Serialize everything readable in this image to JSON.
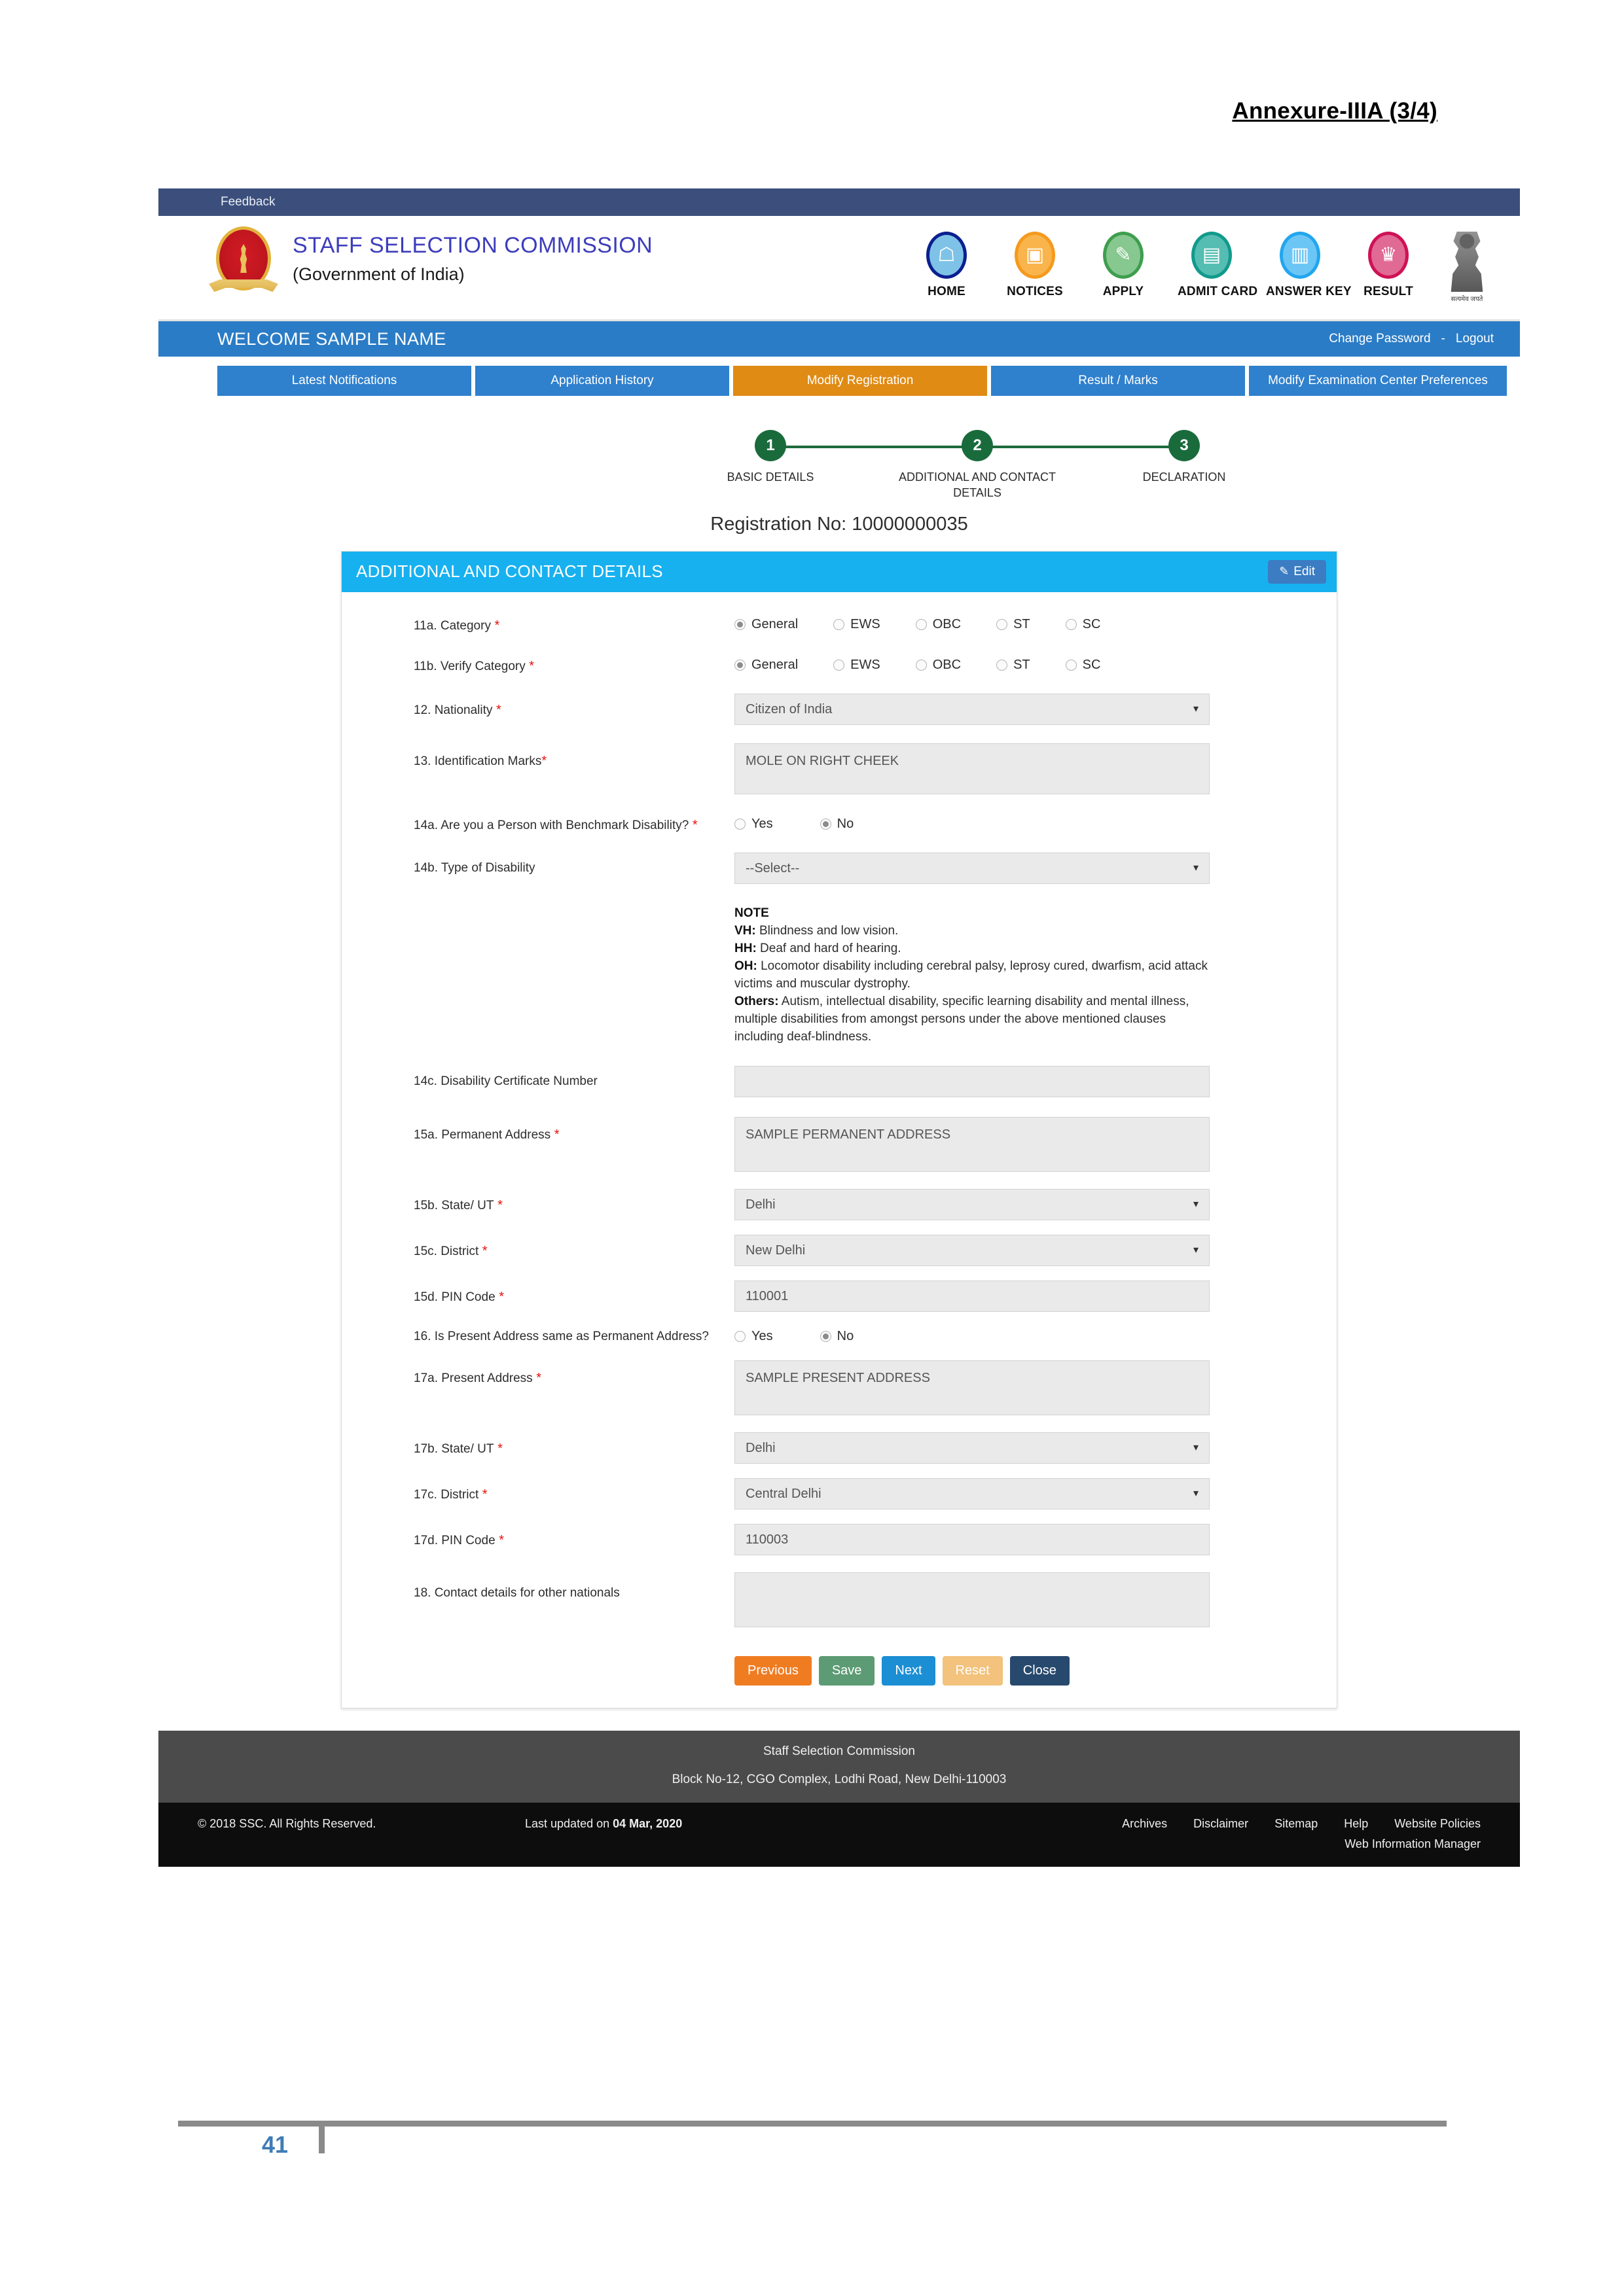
{
  "document": {
    "annexure_label": "Annexure-IIIA (3/4)",
    "page_number": "41"
  },
  "topbar": {
    "feedback_label": "Feedback"
  },
  "brand": {
    "title": "STAFF SELECTION COMMISSION",
    "subtitle": "(Government of India)",
    "logo_icon": "ssc-emblem-icon",
    "national_emblem_icon": "india-national-emblem-icon",
    "national_emblem_caption": "सत्यमेव जयते"
  },
  "nav": {
    "items": [
      {
        "label": "HOME",
        "icon": "home-icon",
        "glyph": "⌂",
        "ring": "#0b1f8f",
        "fill": "#7ec2e8"
      },
      {
        "label": "NOTICES",
        "icon": "notices-icon",
        "glyph": "▣",
        "ring": "#f59a1e",
        "fill": "#f9b44c"
      },
      {
        "label": "APPLY",
        "icon": "apply-edit-icon",
        "glyph": "✎",
        "ring": "#3f9e4e",
        "fill": "#86c88f"
      },
      {
        "label": "ADMIT CARD",
        "icon": "admit-card-icon",
        "glyph": "▤",
        "ring": "#119a8c",
        "fill": "#55bdb2"
      },
      {
        "label": "ANSWER KEY",
        "icon": "answer-key-icon",
        "glyph": "▥",
        "ring": "#22a6ef",
        "fill": "#6cc6f5"
      },
      {
        "label": "RESULT",
        "icon": "result-trophy-icon",
        "glyph": "♜",
        "ring": "#cf1155",
        "fill": "#e06a93"
      }
    ]
  },
  "welcome": {
    "greeting": "WELCOME SAMPLE NAME",
    "change_password": "Change Password",
    "separator": "-",
    "logout": "Logout"
  },
  "tabs": [
    {
      "label": "Latest Notifications",
      "active": false
    },
    {
      "label": "Application History",
      "active": false
    },
    {
      "label": "Modify Registration",
      "active": true
    },
    {
      "label": "Result / Marks",
      "active": false
    },
    {
      "label": "Modify Examination Center Preferences",
      "active": false
    }
  ],
  "stepper": {
    "steps": [
      {
        "number": "1",
        "label": "BASIC DETAILS"
      },
      {
        "number": "2",
        "label": "ADDITIONAL AND CONTACT DETAILS"
      },
      {
        "number": "3",
        "label": "DECLARATION"
      }
    ],
    "registration_line": "Registration No: 10000000035"
  },
  "panel": {
    "title": "ADDITIONAL AND CONTACT DETAILS",
    "edit_label": "Edit",
    "edit_icon": "pencil-square-icon"
  },
  "fields": {
    "category": {
      "label": "11a. Category",
      "required": true,
      "options": [
        "General",
        "EWS",
        "OBC",
        "ST",
        "SC"
      ],
      "selected": "General"
    },
    "verify_category": {
      "label": "11b. Verify Category",
      "required": true,
      "options": [
        "General",
        "EWS",
        "OBC",
        "ST",
        "SC"
      ],
      "selected": "General"
    },
    "nationality": {
      "label": "12. Nationality",
      "required": true,
      "value": "Citizen of India"
    },
    "identification_marks": {
      "label": "13. Identification Marks",
      "required": true,
      "value": "MOLE ON RIGHT CHEEK"
    },
    "benchmark_disability": {
      "label": "14a. Are you a Person with Benchmark Disability?",
      "required": true,
      "options": [
        "Yes",
        "No"
      ],
      "selected": "No"
    },
    "type_of_disability": {
      "label": "14b. Type of Disability",
      "required": false,
      "value": "--Select--"
    },
    "disability_note": {
      "heading": "NOTE",
      "lines": [
        {
          "term": "VH:",
          "text": " Blindness and low vision."
        },
        {
          "term": "HH:",
          "text": " Deaf and hard of hearing."
        },
        {
          "term": "OH:",
          "text": " Locomotor disability including cerebral palsy, leprosy cured, dwarfism, acid attack victims and muscular dystrophy."
        },
        {
          "term": "Others:",
          "text": " Autism, intellectual disability, specific learning disability and mental illness, multiple disabilities from amongst persons under the above mentioned clauses including deaf-blindness."
        }
      ]
    },
    "disability_certificate": {
      "label": "14c. Disability Certificate Number",
      "required": false,
      "value": ""
    },
    "permanent_address": {
      "label": "15a. Permanent Address",
      "required": true,
      "value": "SAMPLE PERMANENT ADDRESS"
    },
    "permanent_state": {
      "label": "15b. State/ UT",
      "required": true,
      "value": "Delhi"
    },
    "permanent_district": {
      "label": "15c. District",
      "required": true,
      "value": "New Delhi"
    },
    "permanent_pin": {
      "label": "15d. PIN Code",
      "required": true,
      "value": "110001"
    },
    "same_address": {
      "label": "16. Is Present Address same as Permanent Address?",
      "required": false,
      "options": [
        "Yes",
        "No"
      ],
      "selected": "No"
    },
    "present_address": {
      "label": "17a. Present Address",
      "required": true,
      "value": "SAMPLE PRESENT ADDRESS"
    },
    "present_state": {
      "label": "17b. State/ UT",
      "required": true,
      "value": "Delhi"
    },
    "present_district": {
      "label": "17c. District",
      "required": true,
      "value": "Central Delhi"
    },
    "present_pin": {
      "label": "17d. PIN Code",
      "required": true,
      "value": "110003"
    },
    "other_nationals": {
      "label": "18. Contact details for other nationals",
      "required": false,
      "value": ""
    }
  },
  "actions": {
    "previous": "Previous",
    "save": "Save",
    "next": "Next",
    "reset": "Reset",
    "close": "Close"
  },
  "footer": {
    "org": "Staff Selection Commission",
    "address": "Block No-12, CGO Complex, Lodhi Road, New Delhi-110003",
    "copyright": "© 2018 SSC. All Rights Reserved.",
    "last_updated_prefix": "Last updated on ",
    "last_updated_date": "04 Mar, 2020",
    "links": [
      "Archives",
      "Disclaimer",
      "Sitemap",
      "Help",
      "Website Policies"
    ],
    "wim_link": "Web Information Manager"
  },
  "colors": {
    "feedback_bar": "#3c4f7c",
    "welcome_bar": "#2b7cc6",
    "tab": "#2f80cd",
    "tab_active": "#e08b14",
    "panel_head": "#17b1f0",
    "edit_button": "#3b7cc2",
    "step_circle": "#1a6b3c",
    "required_star": "#e8110c",
    "btn_previous": "#f07c22",
    "btn_save": "#5d9b74",
    "btn_next": "#1c8ed4",
    "btn_reset": "#f3c27c",
    "btn_close": "#27496d",
    "footer_top": "#4b4b4b",
    "footer_bottom": "#0d0d0d",
    "page_number": "#3f7cb6"
  }
}
